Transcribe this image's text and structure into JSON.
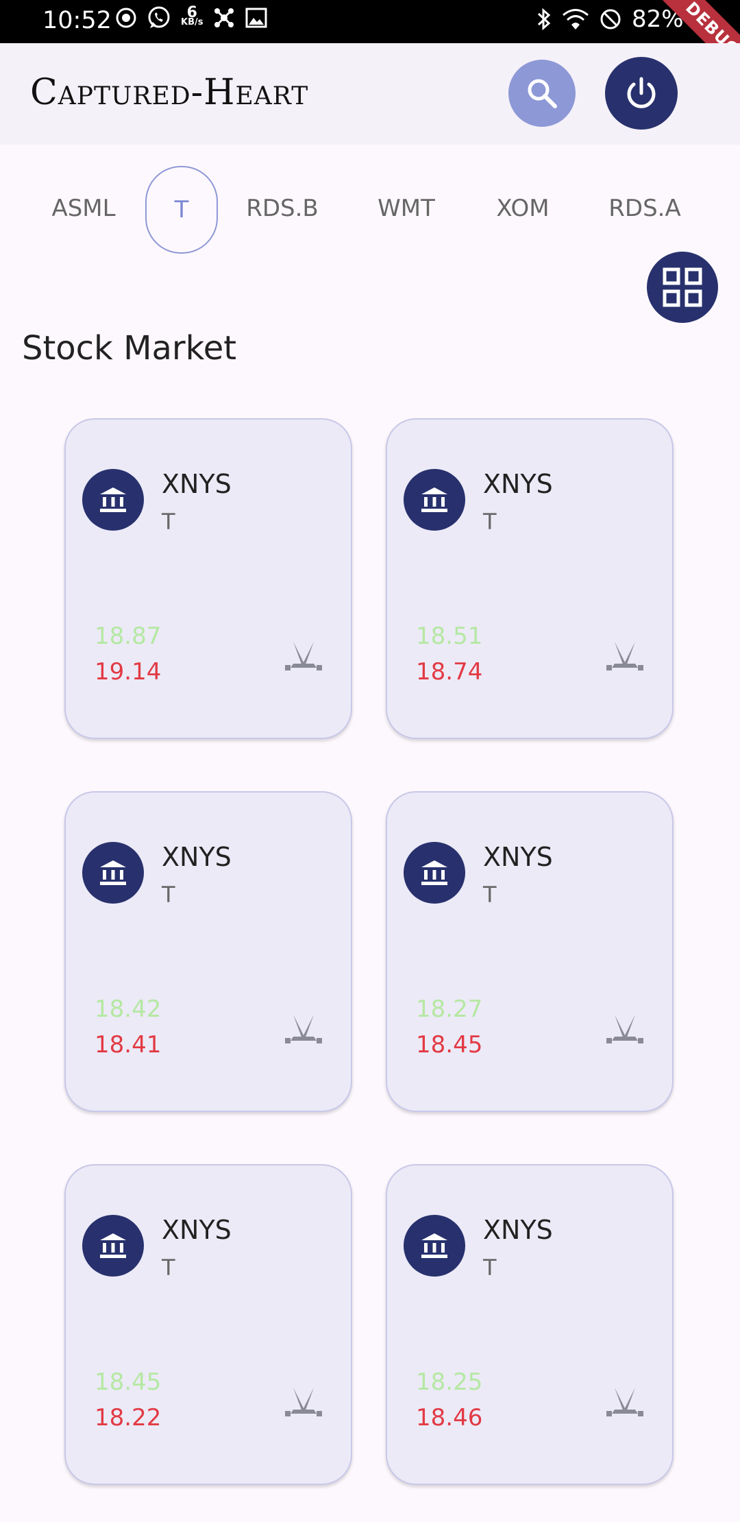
{
  "status_bar": {
    "time": "10:52",
    "speed_value": "6",
    "speed_unit": "KB/s",
    "battery": "82%",
    "icons_left": [
      "play-icon",
      "whatsapp-icon",
      "network-speed-icon",
      "hub-icon",
      "image-icon"
    ],
    "icons_right": [
      "bluetooth-icon",
      "wifi-icon",
      "do-not-disturb-icon",
      "battery-icon"
    ]
  },
  "debug_banner": "DEBUG",
  "app_bar": {
    "title": "Captured-Heart",
    "search_icon": "search-icon",
    "power_icon": "power-icon"
  },
  "tabs": [
    {
      "label": "ASML",
      "active": false
    },
    {
      "label": "T",
      "active": true
    },
    {
      "label": "RDS.B",
      "active": false
    },
    {
      "label": "WMT",
      "active": false
    },
    {
      "label": "XOM",
      "active": false
    },
    {
      "label": "RDS.A",
      "active": false
    }
  ],
  "view_toggle_icon": "grid-view-icon",
  "section_title": "Stock Market",
  "cards": [
    {
      "exchange": "XNYS",
      "symbol": "T",
      "high": "18.87",
      "low": "19.14"
    },
    {
      "exchange": "XNYS",
      "symbol": "T",
      "high": "18.51",
      "low": "18.74"
    },
    {
      "exchange": "XNYS",
      "symbol": "T",
      "high": "18.42",
      "low": "18.41"
    },
    {
      "exchange": "XNYS",
      "symbol": "T",
      "high": "18.27",
      "low": "18.45"
    },
    {
      "exchange": "XNYS",
      "symbol": "T",
      "high": "18.45",
      "low": "18.22"
    },
    {
      "exchange": "XNYS",
      "symbol": "T",
      "high": "18.25",
      "low": "18.46"
    }
  ],
  "colors": {
    "primary": "#28316d",
    "accent": "#8d98d6",
    "price_up": "#b5e8a2",
    "price_down": "#e23a44",
    "card_bg": "#eceaf7"
  }
}
